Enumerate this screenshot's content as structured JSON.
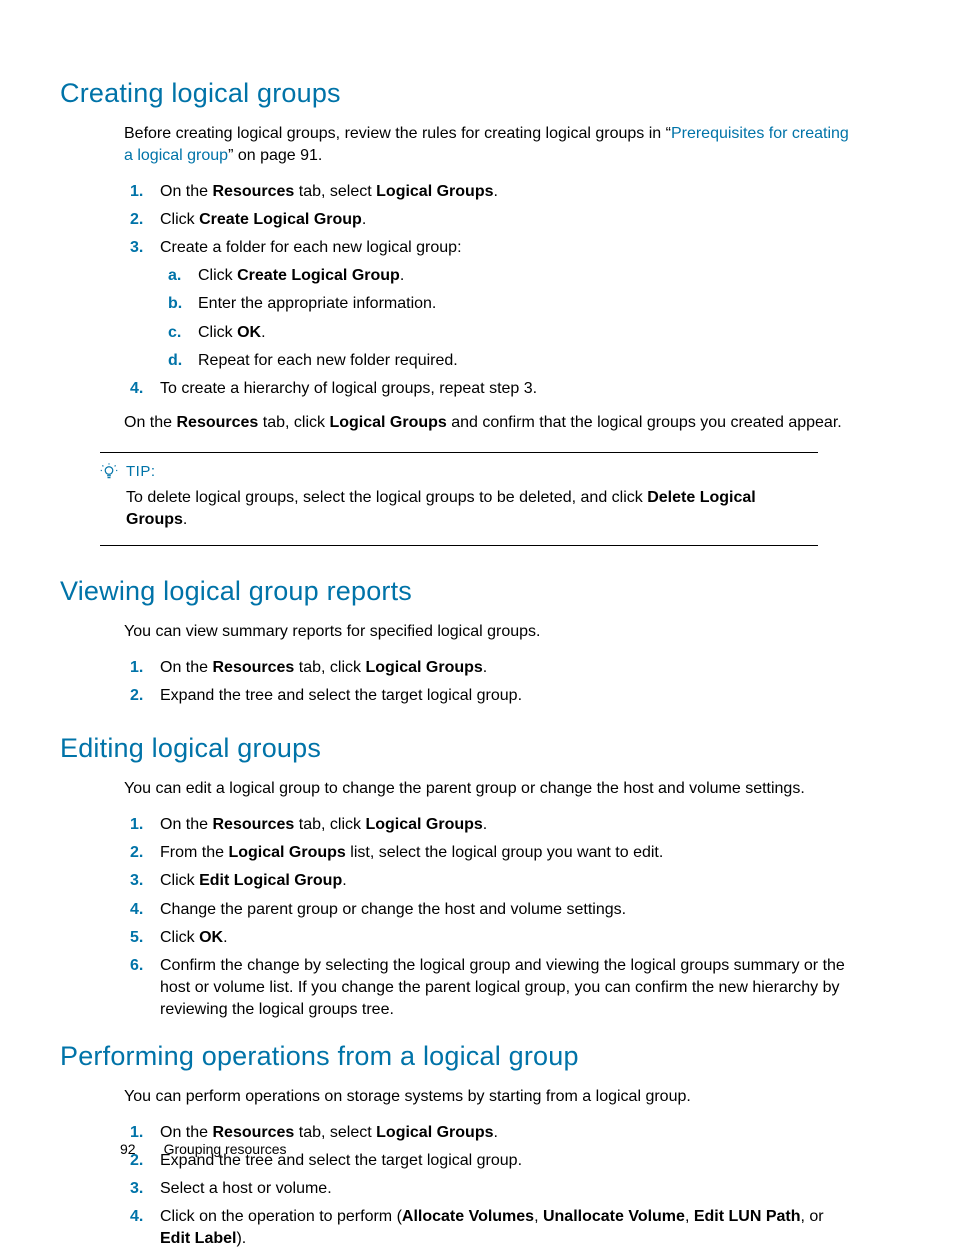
{
  "footer": {
    "page_number": "92",
    "chapter": "Grouping resources"
  },
  "sections": {
    "creating": {
      "title": "Creating logical groups",
      "intro_pre": "Before creating logical groups, review the rules for creating logical groups in “",
      "intro_link": "Prerequisites for creating a logical group",
      "intro_post": "” on page 91.",
      "steps": {
        "s1_pre": "On the ",
        "s1_b1": "Resources",
        "s1_mid": " tab, select ",
        "s1_b2": "Logical Groups",
        "s1_post": ".",
        "s2_pre": "Click ",
        "s2_b1": "Create Logical Group",
        "s2_post": ".",
        "s3": "Create a folder for each new logical group:",
        "s3a_pre": "Click ",
        "s3a_b1": "Create Logical Group",
        "s3a_post": ".",
        "s3b": "Enter the appropriate information.",
        "s3c_pre": "Click ",
        "s3c_b1": "OK",
        "s3c_post": ".",
        "s3d": "Repeat for each new folder required.",
        "s4": "To create a hierarchy of logical groups, repeat step 3."
      },
      "confirm_pre": "On the ",
      "confirm_b1": "Resources",
      "confirm_mid1": " tab, click ",
      "confirm_b2": "Logical Groups",
      "confirm_post": " and confirm that the logical groups you created appear.",
      "tip_label": "TIP:",
      "tip_body_pre": "To delete logical groups, select the logical groups to be deleted, and click ",
      "tip_body_b1": "Delete Logical Groups",
      "tip_body_post": "."
    },
    "viewing": {
      "title": "Viewing logical group reports",
      "intro": "You can view summary reports for specified logical groups.",
      "s1_pre": "On the ",
      "s1_b1": "Resources",
      "s1_mid": " tab, click ",
      "s1_b2": "Logical Groups",
      "s1_post": ".",
      "s2": "Expand the tree and select the target logical group."
    },
    "editing": {
      "title": "Editing logical groups",
      "intro": "You can edit a logical group to change the parent group or change the host and volume settings.",
      "s1_pre": "On the ",
      "s1_b1": "Resources",
      "s1_mid": " tab, click ",
      "s1_b2": "Logical Groups",
      "s1_post": ".",
      "s2_pre": "From the  ",
      "s2_b1": "Logical Groups",
      "s2_post": " list, select the logical group you want to edit.",
      "s3_pre": "Click ",
      "s3_b1": "Edit Logical Group",
      "s3_post": ".",
      "s4": "Change the parent group or change the host and volume settings.",
      "s5_pre": "Click ",
      "s5_b1": "OK",
      "s5_post": ".",
      "s6": "Confirm the change by selecting the logical group and viewing the logical groups summary or the host or volume list. If you change the parent logical group, you can confirm the new hierarchy by reviewing the logical groups tree."
    },
    "performing": {
      "title": "Performing operations from a logical group",
      "intro": "You can perform operations on storage systems by starting from a logical group.",
      "s1_pre": "On the ",
      "s1_b1": "Resources",
      "s1_mid": " tab, select ",
      "s1_b2": "Logical Groups",
      "s1_post": ".",
      "s2": "Expand the tree and select the target logical group.",
      "s3": "Select a host or volume.",
      "s4_pre": "Click on the operation to perform (",
      "s4_b1": "Allocate Volumes",
      "s4_sep1": ", ",
      "s4_b2": "Unallocate Volume",
      "s4_sep2": ", ",
      "s4_b3": "Edit LUN Path",
      "s4_sep3": ", or ",
      "s4_b4": "Edit Label",
      "s4_post": ")."
    }
  }
}
